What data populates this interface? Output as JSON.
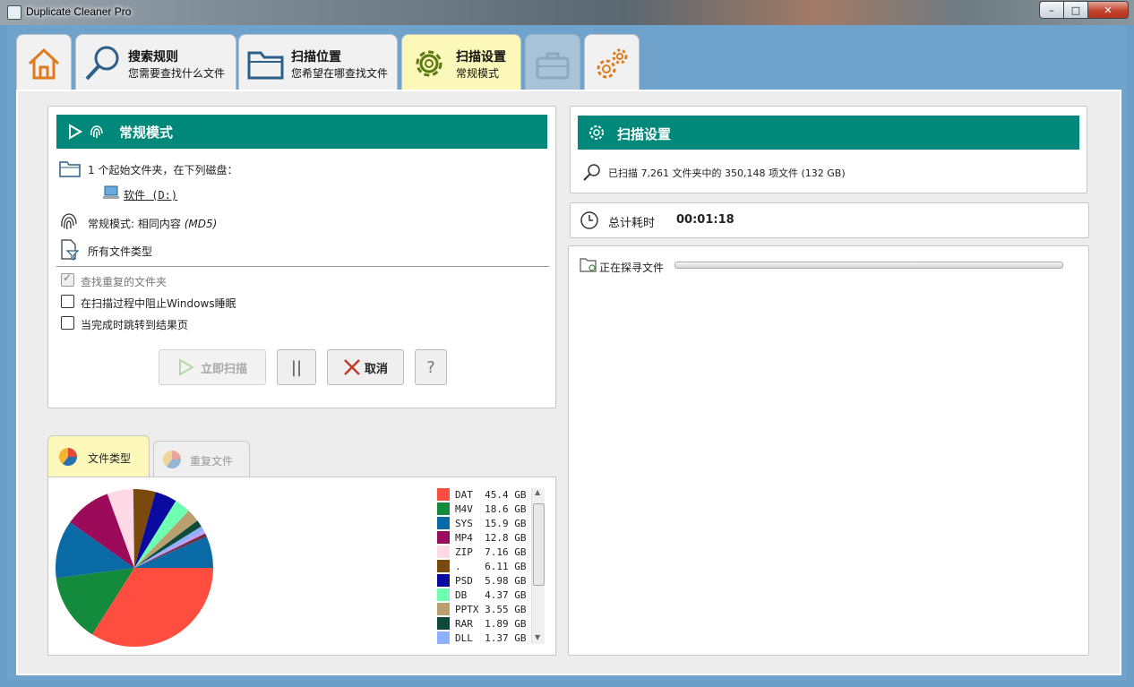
{
  "window": {
    "title": "Duplicate Cleaner Pro",
    "min": "–",
    "max": "□",
    "close": "✕"
  },
  "tabs": [
    {
      "id": "home"
    },
    {
      "id": "search-rules",
      "title": "搜索规则",
      "subtitle": "您需要查找什么文件"
    },
    {
      "id": "scan-location",
      "title": "扫描位置",
      "subtitle": "您希望在哪查找文件"
    },
    {
      "id": "scan-settings",
      "title": "扫描设置",
      "subtitle": "常规模式"
    },
    {
      "id": "toolbox"
    },
    {
      "id": "options"
    }
  ],
  "left_panel": {
    "header": "常规模式",
    "folders_line": "1 个起始文件夹，在下列磁盘：",
    "drive": "软件 (D:)",
    "mode_line": "常规模式: 相同内容",
    "mode_hash": "(MD5)",
    "filetypes_line": "所有文件类型",
    "options": [
      {
        "label": "查找重复的文件夹",
        "checked": true,
        "disabled": true
      },
      {
        "label": "在扫描过程中阻止Windows睡眠",
        "checked": false,
        "disabled": false
      },
      {
        "label": "当完成时跳转到结果页",
        "checked": false,
        "disabled": false
      }
    ],
    "buttons": {
      "scan_now": "立即扫描",
      "pause": "||",
      "cancel": "取消",
      "help": "?"
    }
  },
  "right_panel": {
    "header": "扫描设置",
    "scanned_line": "已扫描 7,261 文件夹中的 350,148 项文件 (132 GB)",
    "elapsed_label": "总计耗时",
    "elapsed_value": "00:01:18",
    "status_label": "正在探寻文件"
  },
  "chart_tabs": {
    "file_types": "文件类型",
    "duplicates": "重复文件"
  },
  "chart_data": {
    "type": "pie",
    "series_unit": "GB",
    "legend": [
      {
        "label": "DAT",
        "value": 45.4,
        "display": "45.4 GB",
        "color": "#ff4d40"
      },
      {
        "label": "M4V",
        "value": 18.6,
        "display": "18.6 GB",
        "color": "#148a3c"
      },
      {
        "label": "SYS",
        "value": 15.9,
        "display": "15.9 GB",
        "color": "#0a6aa5"
      },
      {
        "label": "MP4",
        "value": 12.8,
        "display": "12.8 GB",
        "color": "#9c0a5a"
      },
      {
        "label": "ZIP",
        "value": 7.16,
        "display": "7.16 GB",
        "color": "#ffd9e6"
      },
      {
        "label": ".",
        "value": 6.11,
        "display": "6.11 GB",
        "color": "#7a4a0c"
      },
      {
        "label": "PSD",
        "value": 5.98,
        "display": "5.98 GB",
        "color": "#0a0aa0"
      },
      {
        "label": "DB",
        "value": 4.37,
        "display": "4.37 GB",
        "color": "#6effb2"
      },
      {
        "label": "PPTX",
        "value": 3.55,
        "display": "3.55 GB",
        "color": "#b8a070"
      },
      {
        "label": "RAR",
        "value": 1.89,
        "display": "1.89 GB",
        "color": "#0d4a3a"
      },
      {
        "label": "DLL",
        "value": 1.37,
        "display": "1.37 GB",
        "color": "#8fb0ff"
      }
    ],
    "slices_unlabeled_visible": [
      {
        "value": 0.8,
        "color": "#c2a0ff"
      },
      {
        "value": 0.6,
        "color": "#802020"
      },
      {
        "value": 0.5,
        "color": "#404080"
      },
      {
        "value": 8.5,
        "color": "#0a6aa5"
      }
    ]
  }
}
